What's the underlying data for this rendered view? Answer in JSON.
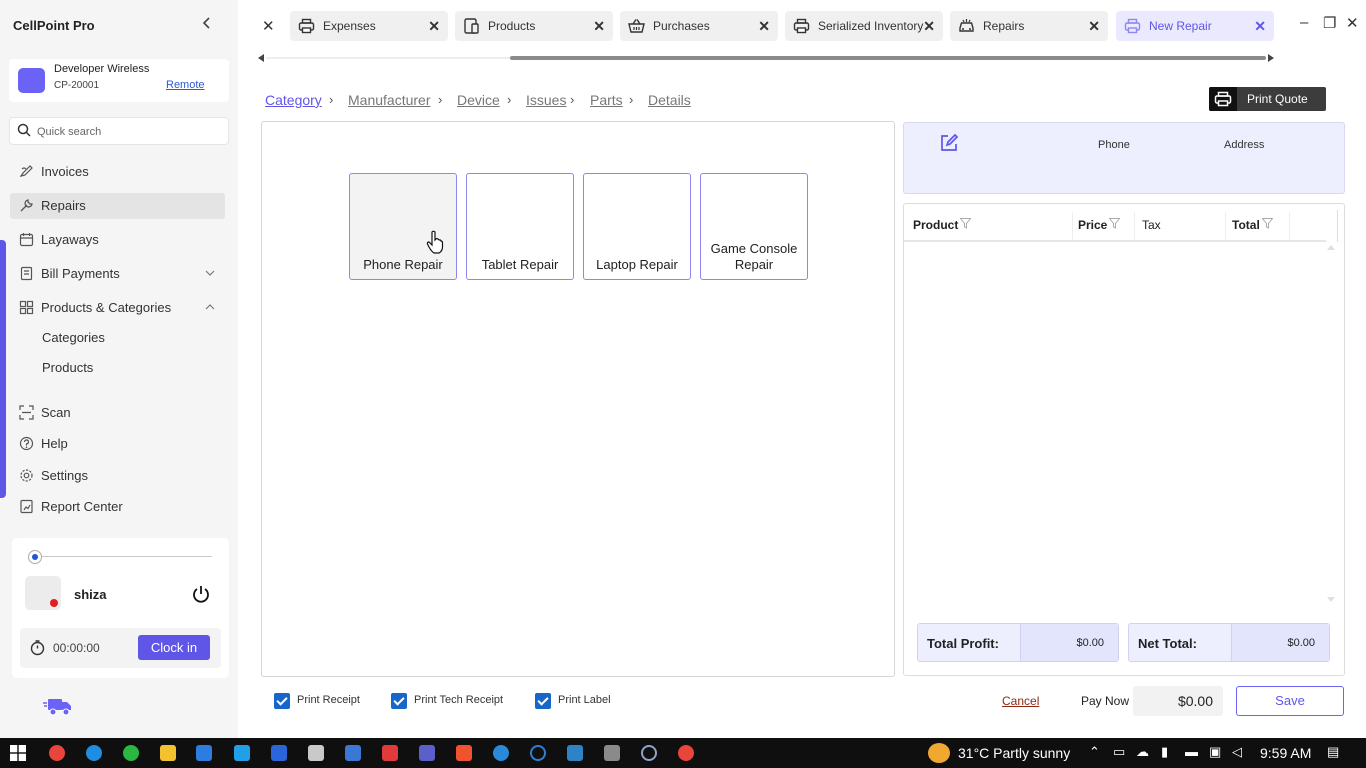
{
  "app": {
    "title": "CellPoint Pro",
    "collapse_icon": "chevron-left-icon"
  },
  "store": {
    "name": "Developer Wireless",
    "id": "CP-20001",
    "mode_link": "Remote",
    "logo_color": "#6b63f6"
  },
  "search": {
    "placeholder": "Quick search",
    "icon": "search-icon"
  },
  "sidebar": {
    "items": [
      {
        "label": "Invoices",
        "icon": "invoice-icon"
      },
      {
        "label": "Repairs",
        "icon": "wrench-icon",
        "active": true
      },
      {
        "label": "Layaways",
        "icon": "calendar-icon"
      },
      {
        "label": "Bill Payments",
        "icon": "bill-icon",
        "expand": "chevron-down-icon"
      },
      {
        "label": "Products & Categories",
        "icon": "grid-icon",
        "expand": "chevron-up-icon"
      },
      {
        "label": "Scan",
        "icon": "scan-icon"
      },
      {
        "label": "Help",
        "icon": "help-icon"
      },
      {
        "label": "Settings",
        "icon": "gear-icon"
      },
      {
        "label": "Report Center",
        "icon": "report-icon"
      }
    ],
    "subitems": [
      {
        "label": "Categories"
      },
      {
        "label": "Products"
      }
    ]
  },
  "user": {
    "name": "shiza",
    "timer": "00:00:00",
    "clock_in_label": "Clock in",
    "status_color": "#e02020"
  },
  "tabs": [
    {
      "label": "Expenses",
      "icon": "printer-icon"
    },
    {
      "label": "Products",
      "icon": "tablet-icon"
    },
    {
      "label": "Purchases",
      "icon": "basket-icon"
    },
    {
      "label": "Serialized Inventory",
      "icon": "printer-icon"
    },
    {
      "label": "Repairs",
      "icon": "car-icon"
    },
    {
      "label": "New Repair",
      "icon": "printer-icon",
      "active": true
    }
  ],
  "breadcrumb": [
    "Category",
    "Manufacturer",
    "Device",
    "Issues",
    "Parts",
    "Details"
  ],
  "print_quote_label": "Print Quote",
  "categories": [
    {
      "label": "Phone Repair"
    },
    {
      "label": "Tablet Repair"
    },
    {
      "label": "Laptop Repair"
    },
    {
      "label": "Game Console Repair"
    }
  ],
  "customer": {
    "phone_label": "Phone",
    "address_label": "Address"
  },
  "table": {
    "columns": [
      "Product",
      "Price",
      "Tax",
      "Total"
    ],
    "rows": []
  },
  "totals": {
    "profit_label": "Total Profit:",
    "profit_value": "$0.00",
    "net_label": "Net Total:",
    "net_value": "$0.00"
  },
  "footer": {
    "checkboxes": [
      {
        "label": "Print Receipt",
        "checked": true
      },
      {
        "label": "Print Tech Receipt",
        "checked": true
      },
      {
        "label": "Print Label",
        "checked": true
      }
    ],
    "cancel_label": "Cancel",
    "pay_now_label": "Pay Now",
    "pay_amount": "$0.00",
    "save_label": "Save"
  },
  "taskbar": {
    "weather": "31°C  Partly sunny",
    "time": "9:59 AM"
  },
  "colors": {
    "accent": "#5f56e8",
    "accent_light": "#edeefe",
    "checkbox": "#1766c9"
  }
}
